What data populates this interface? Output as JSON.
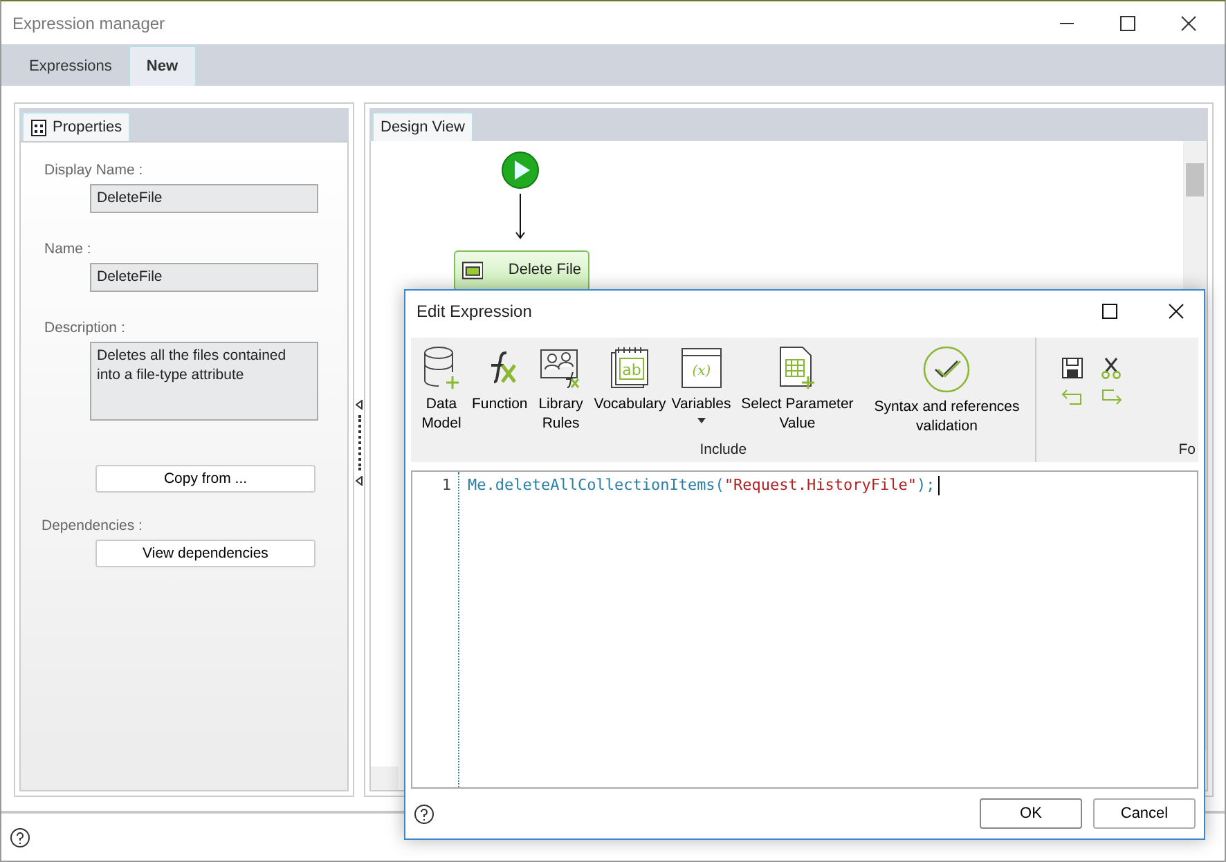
{
  "window": {
    "title": "Expression manager"
  },
  "tabs": [
    {
      "label": "Expressions",
      "selected": false
    },
    {
      "label": "New",
      "selected": true
    }
  ],
  "properties": {
    "tab": "Properties",
    "fields": [
      {
        "label": "Display Name :",
        "value": "DeleteFile",
        "kind": "single"
      },
      {
        "label": "Name :",
        "value": "DeleteFile",
        "kind": "single"
      },
      {
        "label": "Description :",
        "value": "Deletes all the files contained into a file-type attribute",
        "kind": "multi"
      }
    ],
    "copy_button": "Copy from ...",
    "dependencies_label": "Dependencies :",
    "dependencies_button": "View dependencies"
  },
  "design_view": {
    "tab": "Design View",
    "node": "Delete File"
  },
  "dialog": {
    "title": "Edit Expression",
    "ribbon": [
      {
        "label": "Data Model",
        "kind": "database",
        "dropdown": false
      },
      {
        "label": "Function",
        "kind": "fx",
        "dropdown": false
      },
      {
        "label": "Library Rules",
        "kind": "library",
        "dropdown": false
      },
      {
        "label": "Vocabulary",
        "kind": "vocab",
        "glyph": "ab",
        "dropdown": false
      },
      {
        "label": "Variables",
        "kind": "variables",
        "glyph": "(x)",
        "dropdown": true
      },
      {
        "label": "Select Parameter Value",
        "kind": "table",
        "dropdown": false
      },
      {
        "label": "Syntax and references validation",
        "kind": "check",
        "dropdown": false
      }
    ],
    "group_label": "Include",
    "group_label_2": "Fo",
    "editor": {
      "lines": [
        {
          "number": "1",
          "tokens": [
            {
              "text": "Me.deleteAllCollectionItems(",
              "kind": "code"
            },
            {
              "text": "\"Request.HistoryFile\"",
              "kind": "string"
            },
            {
              "text": ");",
              "kind": "code"
            }
          ]
        }
      ]
    },
    "buttons": [
      "OK",
      "Cancel"
    ]
  }
}
